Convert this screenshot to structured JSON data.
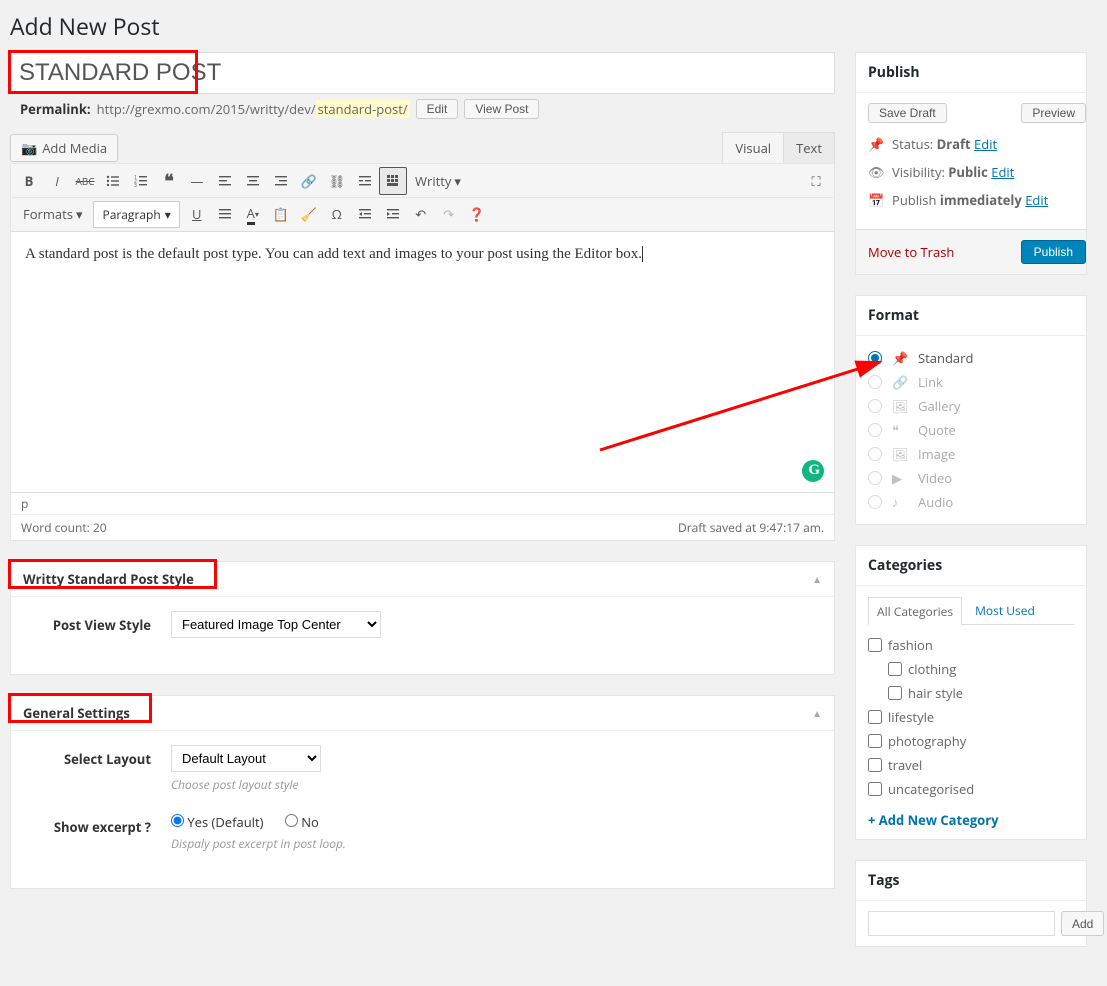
{
  "page_title": "Add New Post",
  "title_input_value": "STANDARD POST",
  "permalink": {
    "label": "Permalink:",
    "base": "http://grexmo.com/2015/writty/dev/",
    "slug": "standard-post/",
    "edit": "Edit",
    "view": "View Post"
  },
  "add_media": "Add Media",
  "editor_tabs": {
    "visual": "Visual",
    "text": "Text"
  },
  "toolbar": {
    "writty": "Writty",
    "formats": "Formats",
    "paragraph": "Paragraph"
  },
  "editor_content": "A standard post is the default post type. You can add text and images to your post using the Editor box.",
  "status": {
    "path": "p",
    "word_count": "Word count: 20",
    "draft_saved": "Draft saved at 9:47:17 am."
  },
  "panels": {
    "style_title": "Writty Standard Post Style",
    "post_view_style_label": "Post View Style",
    "post_view_style_value": "Featured Image Top Center",
    "general_title": "General Settings",
    "select_layout_label": "Select Layout",
    "select_layout_value": "Default Layout",
    "select_layout_help": "Choose post layout style",
    "show_excerpt_label": "Show excerpt ?",
    "show_excerpt_yes": "Yes (Default)",
    "show_excerpt_no": "No",
    "show_excerpt_help": "Dispaly post excerpt in post loop."
  },
  "publish": {
    "title": "Publish",
    "save_draft": "Save Draft",
    "preview": "Preview",
    "status_label": "Status:",
    "status_value": "Draft",
    "visibility_label": "Visibility:",
    "visibility_value": "Public",
    "publish_label": "Publish",
    "publish_value": "immediately",
    "edit": "Edit",
    "trash": "Move to Trash",
    "publish_btn": "Publish"
  },
  "format": {
    "title": "Format",
    "options": [
      "Standard",
      "Link",
      "Gallery",
      "Quote",
      "Image",
      "Video",
      "Audio"
    ]
  },
  "categories": {
    "title": "Categories",
    "tab_all": "All Categories",
    "tab_most": "Most Used",
    "items": [
      {
        "label": "fashion",
        "sub": false
      },
      {
        "label": "clothing",
        "sub": true
      },
      {
        "label": "hair style",
        "sub": true
      },
      {
        "label": "lifestyle",
        "sub": false
      },
      {
        "label": "photography",
        "sub": false
      },
      {
        "label": "travel",
        "sub": false
      },
      {
        "label": "uncategorised",
        "sub": false
      }
    ],
    "add_new": "+ Add New Category"
  },
  "tags": {
    "title": "Tags",
    "add": "Add"
  }
}
